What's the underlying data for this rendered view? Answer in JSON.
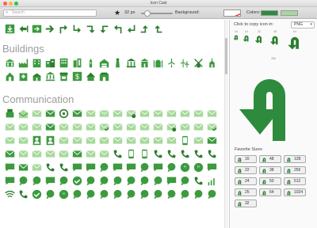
{
  "window": {
    "title": "Icon Cast"
  },
  "toolbar": {
    "search_placeholder": "Search",
    "size_label": "32 px",
    "size_value": 32,
    "background_label": "Background:",
    "colors_label": "Colors:",
    "color_primary": "#2e8b3d",
    "color_secondary": "#a6d99a"
  },
  "colors": {
    "icon_green": "#3c9a3f",
    "icon_dark": "#2b7d2e",
    "section_gray": "#9b9b9b"
  },
  "sections": [
    {
      "title": "Buildings",
      "icons": [
        "city-hall-icon",
        "factory-icon",
        "office-building-icon",
        "apartment-icon",
        "hotel-icon",
        "skyscraper-icon",
        "tower-icon",
        "warehouse-icon",
        "lighthouse-icon",
        "museum-icon",
        "temple-icon",
        "mosque-icon",
        "wind-turbine-icon",
        "windmill-icon",
        "church-icon",
        "chapel-icon",
        "hospital-icon",
        "school-icon",
        "bank-icon",
        "library-icon",
        "shop-icon",
        "bank-dollar-icon",
        "hut-icon",
        "restaurant-icon"
      ]
    },
    {
      "title": "Communication",
      "icons": [
        "fax-icon",
        "open-mail-icon",
        "envelope-icon",
        "mail-send-icon",
        "at-sign-icon",
        "mail-closed-icon",
        "mail-user-icon",
        "mail-check-icon",
        "mail-stack-icon",
        "mail-remove-icon"
      ]
    }
  ],
  "right_pane": {
    "copy_label": "Click to copy icon in:",
    "format": "PNG",
    "preview_sizes": [
      "16",
      "24",
      "32",
      "48",
      "64"
    ],
    "big_preview_size": "256",
    "favorite_title": "Favorite Sizes",
    "favorites": [
      "16",
      "48",
      "128",
      "22",
      "38",
      "256",
      "24",
      "50",
      "512",
      "25",
      "64",
      "1024",
      "32"
    ]
  }
}
